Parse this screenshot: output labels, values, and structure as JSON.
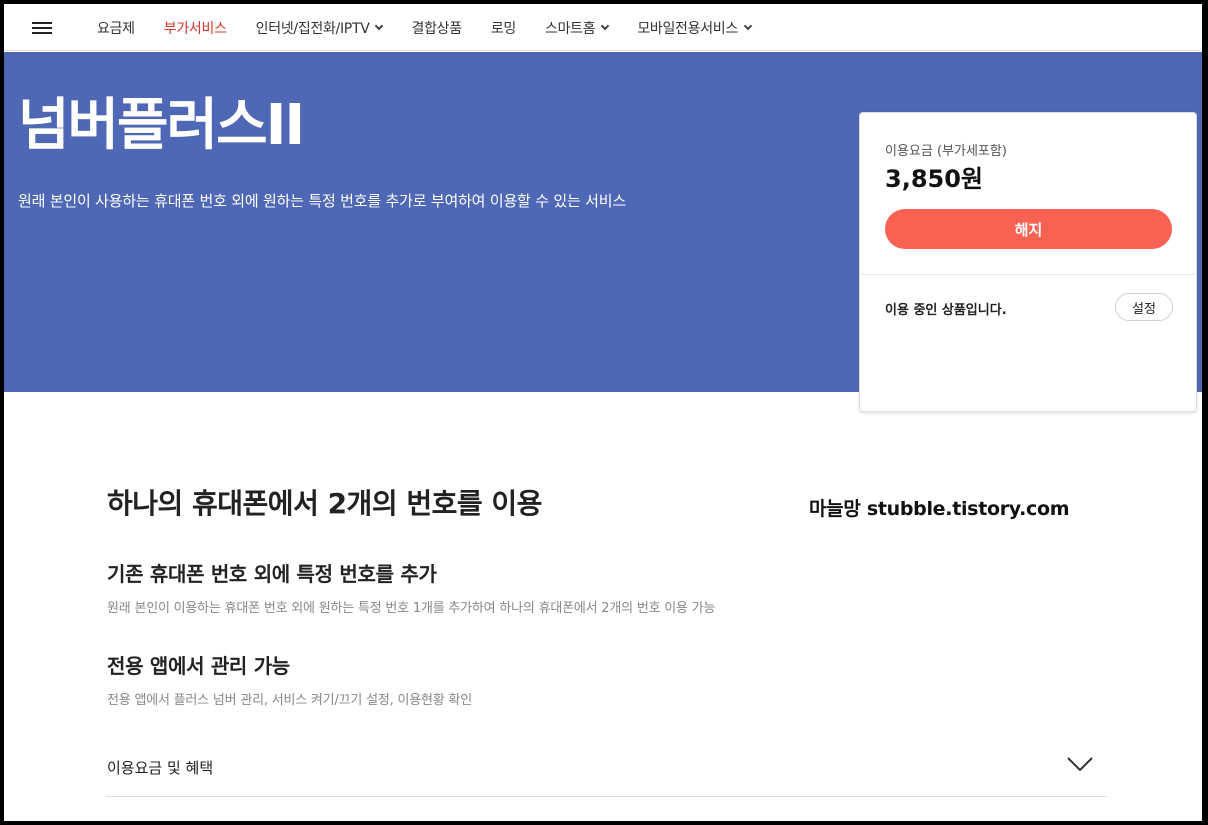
{
  "nav": {
    "items": [
      {
        "label": "요금제",
        "dropdown": false,
        "active": false
      },
      {
        "label": "부가서비스",
        "dropdown": false,
        "active": true
      },
      {
        "label": "인터넷/집전화/IPTV",
        "dropdown": true,
        "active": false
      },
      {
        "label": "결합상품",
        "dropdown": false,
        "active": false
      },
      {
        "label": "로밍",
        "dropdown": false,
        "active": false
      },
      {
        "label": "스마트홈",
        "dropdown": true,
        "active": false
      },
      {
        "label": "모바일전용서비스",
        "dropdown": true,
        "active": false
      }
    ]
  },
  "hero": {
    "title": "넘버플러스II",
    "description": "원래 본인이 사용하는 휴대폰 번호 외에 원하는 특정 번호를 추가로 부여하여 이용할 수 있는 서비스",
    "background": "#4f68b5"
  },
  "card": {
    "price_label": "이용요금 (부가세포함)",
    "price_value": "3,850원",
    "cancel_label": "해지",
    "cancel_color": "#f96253",
    "status_text": "이용 중인 상품입니다.",
    "settings_label": "설정"
  },
  "content": {
    "section_title": "하나의 휴대폰에서 2개의 번호를 이용",
    "watermark": "마늘망 stubble.tistory.com",
    "features": [
      {
        "title": "기존 휴대폰 번호 외에 특정 번호를 추가",
        "desc": "원래 본인이 이용하는 휴대폰 번호 외에 원하는 특정 번호 1개를 추가하여 하나의 휴대폰에서 2개의 번호 이용 가능"
      },
      {
        "title": "전용 앱에서 관리 가능",
        "desc": "전용 앱에서 플러스 넘버 관리, 서비스 켜기/끄기 설정, 이용현황 확인"
      }
    ],
    "accordion_label": "이용요금 및 혜택"
  }
}
